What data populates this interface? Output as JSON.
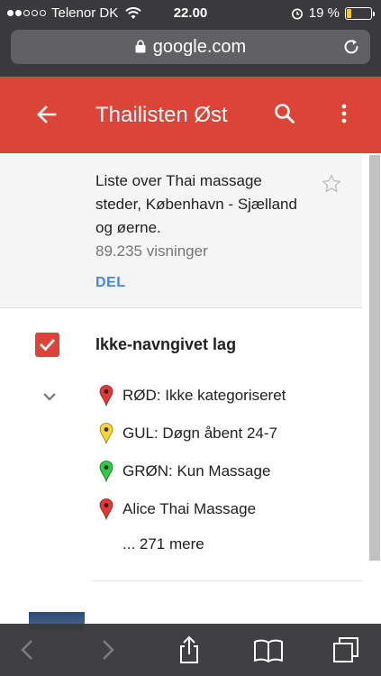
{
  "status_bar": {
    "carrier": "Telenor DK",
    "time": "22.00",
    "battery": "19 %",
    "battery_level": 0.19
  },
  "browser": {
    "url": "google.com"
  },
  "app_bar": {
    "title": "Thailisten Øst"
  },
  "map_info": {
    "description": "Liste over Thai massage steder, København - Sjælland og øerne.",
    "views": "89.235 visninger",
    "share_label": "DEL"
  },
  "layer": {
    "title": "Ikke-navngivet lag",
    "checked": true,
    "items": [
      {
        "label": "RØD: Ikke kategoriseret",
        "pin_color": "#e53935"
      },
      {
        "label": "GUL: Døgn åbent 24-7",
        "pin_color": "#fdd835"
      },
      {
        "label": "GRØN: Kun Massage",
        "pin_color": "#2ecc40"
      },
      {
        "label": "Alice Thai Massage",
        "pin_color": "#e53935"
      }
    ],
    "more": "... 271 mere"
  },
  "colors": {
    "accent": "#db4437",
    "link": "#4285f4"
  }
}
